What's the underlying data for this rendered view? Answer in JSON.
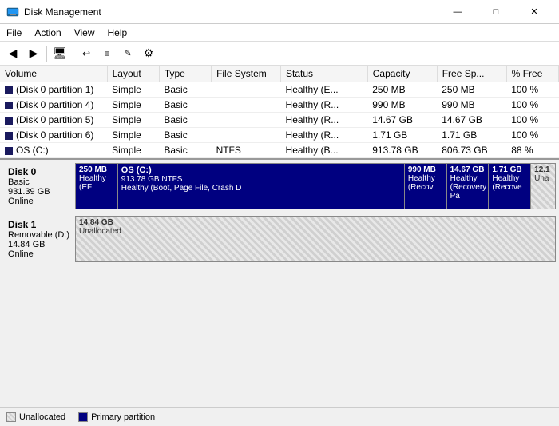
{
  "titlebar": {
    "title": "Disk Management",
    "icon_label": "disk-management-icon",
    "minimize": "—",
    "maximize": "□",
    "close": "✕"
  },
  "menubar": {
    "items": [
      {
        "label": "File",
        "id": "file"
      },
      {
        "label": "Action",
        "id": "action"
      },
      {
        "label": "View",
        "id": "view"
      },
      {
        "label": "Help",
        "id": "help"
      }
    ]
  },
  "toolbar": {
    "buttons": [
      {
        "icon": "◀",
        "name": "back-btn"
      },
      {
        "icon": "▶",
        "name": "forward-btn"
      },
      {
        "icon": "🖥",
        "name": "computer-btn"
      },
      {
        "icon": "↩",
        "name": "refresh-btn"
      },
      {
        "icon": "≡",
        "name": "list-btn"
      },
      {
        "icon": "✎",
        "name": "edit-btn"
      },
      {
        "icon": "⚙",
        "name": "settings-btn"
      }
    ]
  },
  "table": {
    "columns": [
      "Volume",
      "Layout",
      "Type",
      "File System",
      "Status",
      "Capacity",
      "Free Sp...",
      "% Free"
    ],
    "rows": [
      {
        "volume": "(Disk 0 partition 1)",
        "layout": "Simple",
        "type": "Basic",
        "fs": "",
        "status": "Healthy (E...",
        "capacity": "250 MB",
        "free": "250 MB",
        "pct": "100 %"
      },
      {
        "volume": "(Disk 0 partition 4)",
        "layout": "Simple",
        "type": "Basic",
        "fs": "",
        "status": "Healthy (R...",
        "capacity": "990 MB",
        "free": "990 MB",
        "pct": "100 %"
      },
      {
        "volume": "(Disk 0 partition 5)",
        "layout": "Simple",
        "type": "Basic",
        "fs": "",
        "status": "Healthy (R...",
        "capacity": "14.67 GB",
        "free": "14.67 GB",
        "pct": "100 %"
      },
      {
        "volume": "(Disk 0 partition 6)",
        "layout": "Simple",
        "type": "Basic",
        "fs": "",
        "status": "Healthy (R...",
        "capacity": "1.71 GB",
        "free": "1.71 GB",
        "pct": "100 %"
      },
      {
        "volume": "OS (C:)",
        "layout": "Simple",
        "type": "Basic",
        "fs": "NTFS",
        "status": "Healthy (B...",
        "capacity": "913.78 GB",
        "free": "806.73 GB",
        "pct": "88 %"
      }
    ]
  },
  "disks": [
    {
      "name": "Disk 0",
      "type": "Basic",
      "size": "931.39 GB",
      "status": "Online",
      "partitions": [
        {
          "size": "250 MB",
          "label": "Healthy (EF",
          "type": "blue",
          "flex": 1
        },
        {
          "size": "OS  (C:)",
          "sublabel": "913.78 GB NTFS",
          "label3": "Healthy (Boot, Page File, Crash D",
          "type": "blue-os",
          "flex": 8
        },
        {
          "size": "990 MB",
          "label": "Healthy (Recov",
          "type": "blue",
          "flex": 1
        },
        {
          "size": "14.67 GB",
          "label": "Healthy (Recovery Pa",
          "type": "blue",
          "flex": 1
        },
        {
          "size": "1.71 GB",
          "label": "Healthy (Recove",
          "type": "blue",
          "flex": 1
        },
        {
          "size": "12.1",
          "label": "Una",
          "type": "unallocated",
          "flex": 0.5
        }
      ]
    },
    {
      "name": "Disk 1",
      "type": "Removable (D:)",
      "size": "14.84 GB",
      "status": "Online",
      "partitions": [
        {
          "size": "14.84 GB",
          "label": "Unallocated",
          "type": "unallocated",
          "flex": 1
        }
      ]
    }
  ],
  "legend": {
    "items": [
      {
        "type": "unalloc",
        "label": "Unallocated"
      },
      {
        "type": "primary",
        "label": "Primary partition"
      }
    ]
  }
}
